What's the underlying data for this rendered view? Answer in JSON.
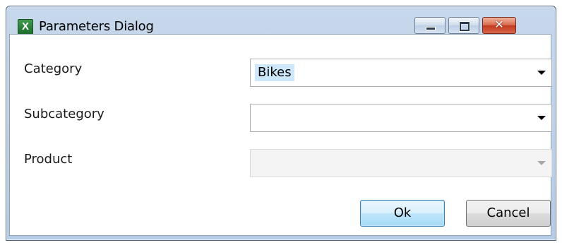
{
  "window": {
    "title": "Parameters Dialog",
    "app_icon_glyph": "X",
    "app_icon_name": "excel-icon",
    "close_glyph": "✕"
  },
  "form": {
    "category": {
      "label": "Category",
      "value": "Bikes"
    },
    "subcategory": {
      "label": "Subcategory",
      "value": ""
    },
    "product": {
      "label": "Product",
      "value": "",
      "disabled": true
    }
  },
  "buttons": {
    "ok_label": "Ok",
    "cancel_label": "Cancel"
  },
  "colors": {
    "title_bar": "#c7d8ec",
    "selection_highlight": "#cde8fb",
    "close_button": "#c13a1f",
    "default_button_border": "#3c7fb1"
  }
}
